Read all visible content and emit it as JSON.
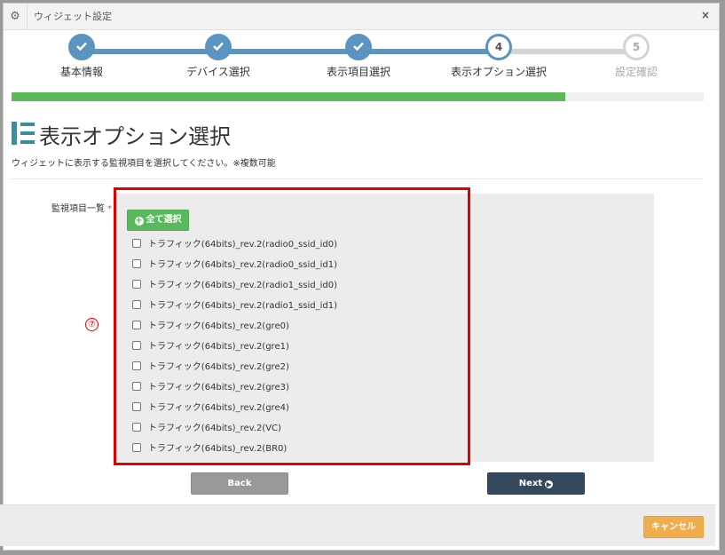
{
  "window": {
    "title": "ウィジェット設定",
    "gear_icon": "gear-icon",
    "close_icon": "close-icon"
  },
  "wizard": {
    "steps": [
      {
        "number": "1",
        "label": "基本情報",
        "status": "done"
      },
      {
        "number": "2",
        "label": "デバイス選択",
        "status": "done"
      },
      {
        "number": "3",
        "label": "表示項目選択",
        "status": "done"
      },
      {
        "number": "4",
        "label": "表示オプション選択",
        "status": "current"
      },
      {
        "number": "5",
        "label": "設定確認",
        "status": "todo"
      }
    ],
    "progress_percent": 80
  },
  "page": {
    "title": "表示オプション選択",
    "description": "ウィジェットに表示する監視項目を選択してください。※複数可能"
  },
  "form": {
    "field_label": "監視項目一覧",
    "required_mark": "*",
    "select_all_label": "全て選択",
    "items": [
      {
        "label": "トラフィック(64bits)_rev.2(radio0_ssid_id0)",
        "checked": false
      },
      {
        "label": "トラフィック(64bits)_rev.2(radio0_ssid_id1)",
        "checked": false
      },
      {
        "label": "トラフィック(64bits)_rev.2(radio1_ssid_id0)",
        "checked": false
      },
      {
        "label": "トラフィック(64bits)_rev.2(radio1_ssid_id1)",
        "checked": false
      },
      {
        "label": "トラフィック(64bits)_rev.2(gre0)",
        "checked": false
      },
      {
        "label": "トラフィック(64bits)_rev.2(gre1)",
        "checked": false
      },
      {
        "label": "トラフィック(64bits)_rev.2(gre2)",
        "checked": false
      },
      {
        "label": "トラフィック(64bits)_rev.2(gre3)",
        "checked": false
      },
      {
        "label": "トラフィック(64bits)_rev.2(gre4)",
        "checked": false
      },
      {
        "label": "トラフィック(64bits)_rev.2(VC)",
        "checked": false
      },
      {
        "label": "トラフィック(64bits)_rev.2(BR0)",
        "checked": false
      }
    ]
  },
  "annotation": {
    "marker": "⑦",
    "highlight_color": "#e00000"
  },
  "buttons": {
    "back": "Back",
    "next": "Next",
    "cancel": "キャンセル"
  },
  "colors": {
    "step_done": "#5b93c1",
    "progress": "#5cb85c",
    "next_button": "#34495e",
    "cancel_button": "#f0ad4e",
    "back_button": "#999999"
  }
}
